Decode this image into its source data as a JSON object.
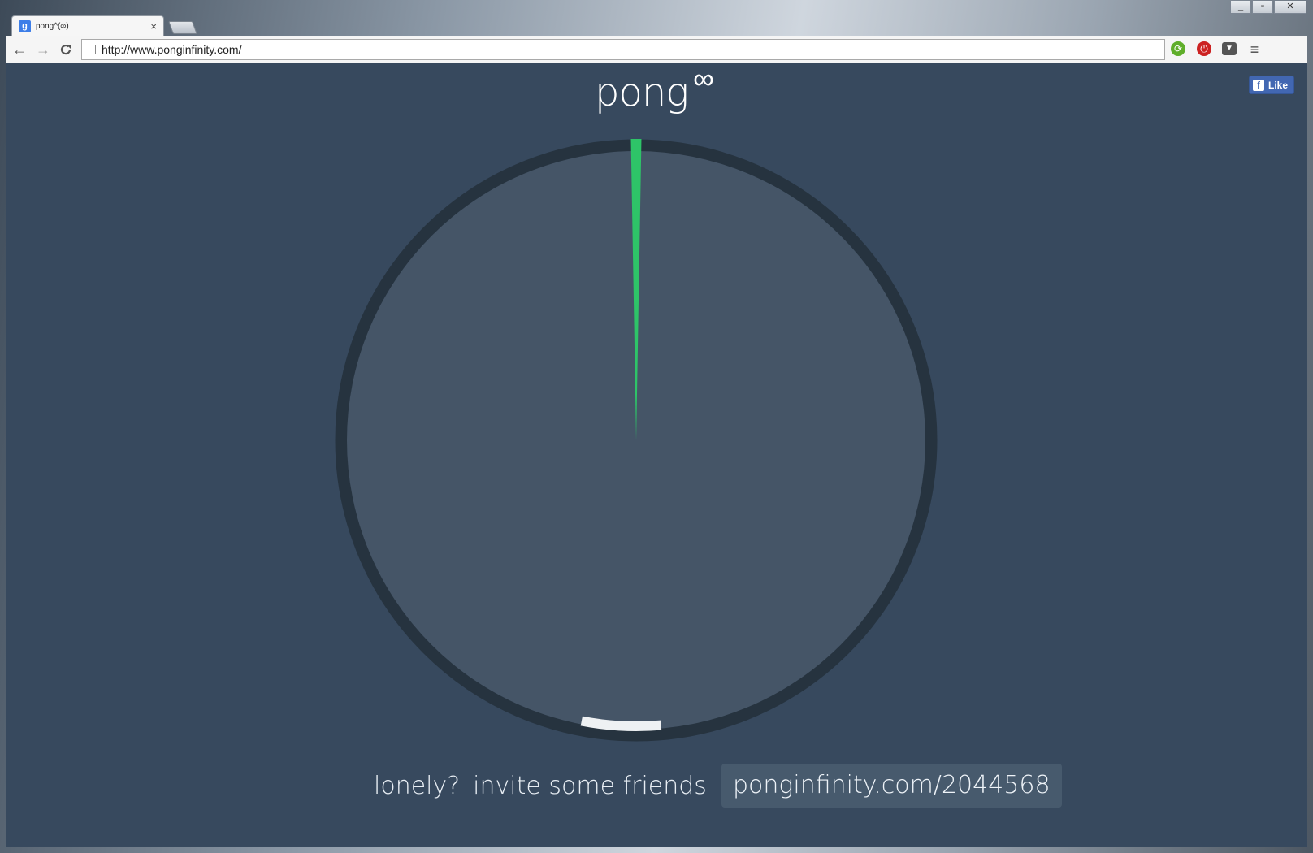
{
  "browser": {
    "tab": {
      "title": "pong^(∞)",
      "favicon": "g"
    },
    "url": "http://www.ponginfinity.com/",
    "window_controls": [
      "_",
      "▫",
      "✕"
    ],
    "nav": {
      "back": "←",
      "forward": "→",
      "reload": "C"
    },
    "extensions": [
      {
        "name": "refresh-extension-icon",
        "glyph": "⟳"
      },
      {
        "name": "stop-extension-icon",
        "glyph": "⏻"
      },
      {
        "name": "pocket-icon",
        "glyph": "▼"
      },
      {
        "name": "menu-icon",
        "glyph": "≡"
      }
    ]
  },
  "page": {
    "logo": {
      "text": "pong",
      "superscript": "∞"
    },
    "facebook": {
      "icon": "f",
      "label": "Like"
    },
    "invite": {
      "question": "lonely?",
      "text": "invite some friends",
      "link": "ponginfinity.com/2044568"
    }
  },
  "game": {
    "colors": {
      "arena_fill": "#455567",
      "ring": "#26333f",
      "player_wedge": "#2ec468",
      "paddle": "#eef1f3",
      "background": "#37495e"
    },
    "player_wedge_angle_deg": 2,
    "paddle_angle_deg": 183
  }
}
